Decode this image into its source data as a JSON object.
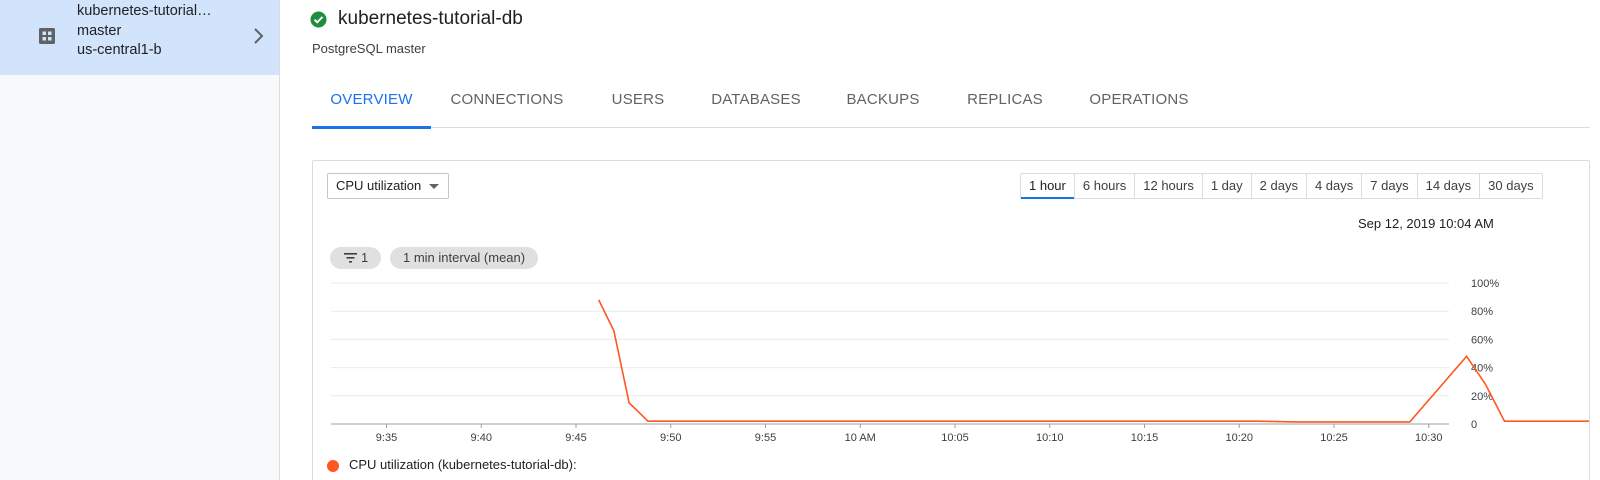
{
  "sidebar": {
    "instance": {
      "name": "kubernetes-tutorial…",
      "role": "master",
      "zone": "us-central1-b",
      "icon": "instance-grid-icon"
    }
  },
  "header": {
    "title": "kubernetes-tutorial-db",
    "subtitle": "PostgreSQL master",
    "status_icon": "check-circle-icon",
    "status_color": "#1e8e3e"
  },
  "tabs": [
    {
      "label": "OVERVIEW",
      "active": true
    },
    {
      "label": "CONNECTIONS",
      "active": false
    },
    {
      "label": "USERS",
      "active": false
    },
    {
      "label": "DATABASES",
      "active": false
    },
    {
      "label": "BACKUPS",
      "active": false
    },
    {
      "label": "REPLICAS",
      "active": false
    },
    {
      "label": "OPERATIONS",
      "active": false
    }
  ],
  "chart_panel": {
    "metric_selected": "CPU utilization",
    "ranges": [
      "1 hour",
      "6 hours",
      "12 hours",
      "1 day",
      "2 days",
      "4 days",
      "7 days",
      "14 days",
      "30 days"
    ],
    "active_range": "1 hour",
    "timestamp": "Sep 12, 2019 10:04 AM",
    "filter_count": "1",
    "interval": "1 min interval (mean)",
    "legend_label": "CPU utilization (kubernetes-tutorial-db):"
  },
  "colors": {
    "accent": "#1a73e8",
    "series": "#ff5722",
    "selected_row": "#d2e3fc"
  },
  "chart_data": {
    "type": "line",
    "title": "",
    "xlabel": "",
    "ylabel": "",
    "x_ticks": [
      "9:35",
      "9:40",
      "9:45",
      "9:50",
      "9:55",
      "10 AM",
      "10:05",
      "10:10",
      "10:15",
      "10:20",
      "10:25",
      "10:30"
    ],
    "y_ticks": [
      "0",
      "20%",
      "40%",
      "60%",
      "80%",
      "100%"
    ],
    "ylim": [
      0,
      100
    ],
    "grid": true,
    "series": [
      {
        "name": "CPU utilization (kubernetes-tutorial-db):",
        "x_minutes_after_933": [
          13.2,
          14.0,
          14.8,
          15.8,
          20,
          30,
          40,
          48,
          50,
          54,
          56,
          59,
          60,
          61,
          66,
          70,
          75,
          77
        ],
        "values": [
          88,
          66,
          15,
          2,
          2,
          2,
          2,
          2,
          1.5,
          1.5,
          1.5,
          48,
          28,
          2,
          2,
          2,
          2,
          2
        ]
      }
    ]
  }
}
